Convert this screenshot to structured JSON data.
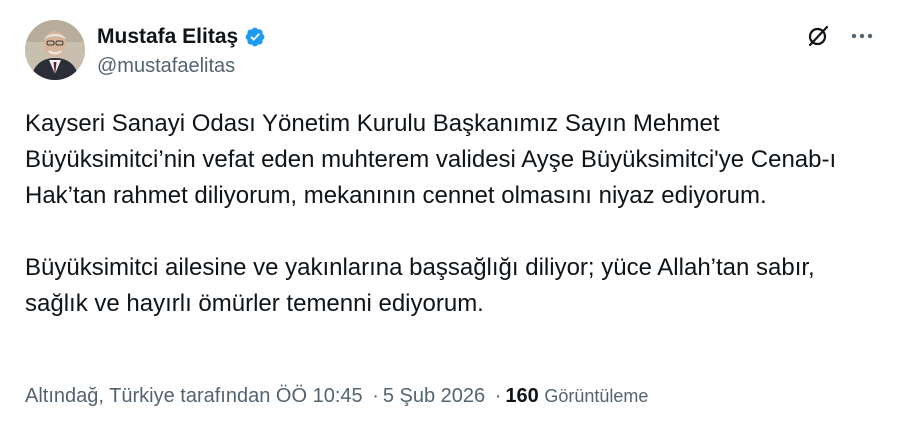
{
  "author": {
    "display_name": "Mustafa Elitaş",
    "handle": "@mustafaelitas",
    "verified": true,
    "verified_color": "#1d9bf0"
  },
  "icons": {
    "grok": "grok-icon",
    "more": "more-icon",
    "verified": "verified-badge-icon"
  },
  "tweet": {
    "paragraphs": [
      "Kayseri Sanayi Odası Yönetim Kurulu Başkanımız Sayın Mehmet Büyüksimitci’nin vefat eden muhterem validesi Ayşe Büyüksimitci'ye Cenab-ı Hak’tan rahmet diliyorum, mekanının cennet olmasını niyaz ediyorum.",
      "Büyüksimitci ailesine ve yakınlarına başsağlığı diliyor; yüce Allah’tan sabır, sağlık ve hayırlı ömürler temenni ediyorum."
    ]
  },
  "meta": {
    "location": "Altındağ, Türkiye tarafından",
    "time": "ÖÖ 10:45",
    "separator": "·",
    "date": "5 Şub 2026",
    "views_count": "160",
    "views_label": "Görüntüleme"
  }
}
